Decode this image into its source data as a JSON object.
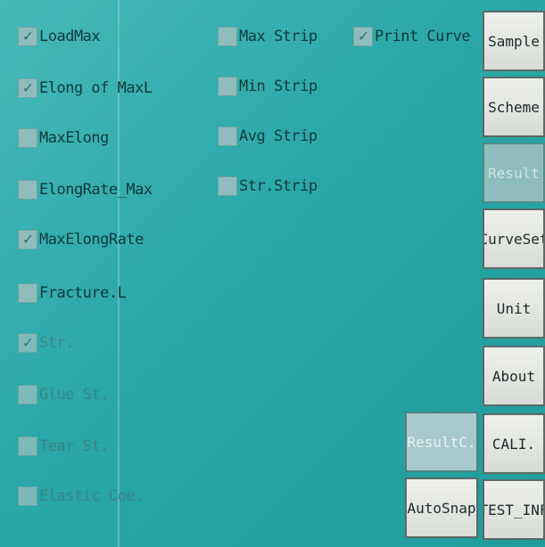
{
  "options_left": [
    {
      "label": "LoadMax",
      "checked": true
    },
    {
      "label": "Elong of MaxL",
      "checked": true
    },
    {
      "label": "MaxElong",
      "checked": false
    },
    {
      "label": "ElongRate_Max",
      "checked": false
    },
    {
      "label": "MaxElongRate",
      "checked": true
    },
    {
      "label": "Fracture.L",
      "checked": false
    },
    {
      "label": "Str.",
      "checked": true
    },
    {
      "label": "Glue St.",
      "checked": false
    },
    {
      "label": "Tear St.",
      "checked": false
    },
    {
      "label": "Elastic Coe.",
      "checked": false
    }
  ],
  "options_mid": [
    {
      "label": "Max Strip",
      "checked": false
    },
    {
      "label": "Min Strip",
      "checked": false
    },
    {
      "label": "Avg Strip",
      "checked": false
    },
    {
      "label": "Str.Strip",
      "checked": false
    }
  ],
  "print_curve": {
    "label": "Print Curve",
    "checked": true
  },
  "menu_buttons": [
    {
      "label": "Sample",
      "state": "enabled"
    },
    {
      "label": "Scheme",
      "state": "enabled"
    },
    {
      "label": "Result",
      "state": "active"
    },
    {
      "label": "CurveSet",
      "state": "enabled"
    },
    {
      "label": "Unit",
      "state": "enabled"
    },
    {
      "label": "About",
      "state": "enabled"
    },
    {
      "label": "CALI.",
      "state": "enabled"
    },
    {
      "label": "TEST_INF",
      "state": "enabled"
    }
  ],
  "action_buttons": {
    "result_c": "ResultC.",
    "auto_snap": "AutoSnap"
  }
}
